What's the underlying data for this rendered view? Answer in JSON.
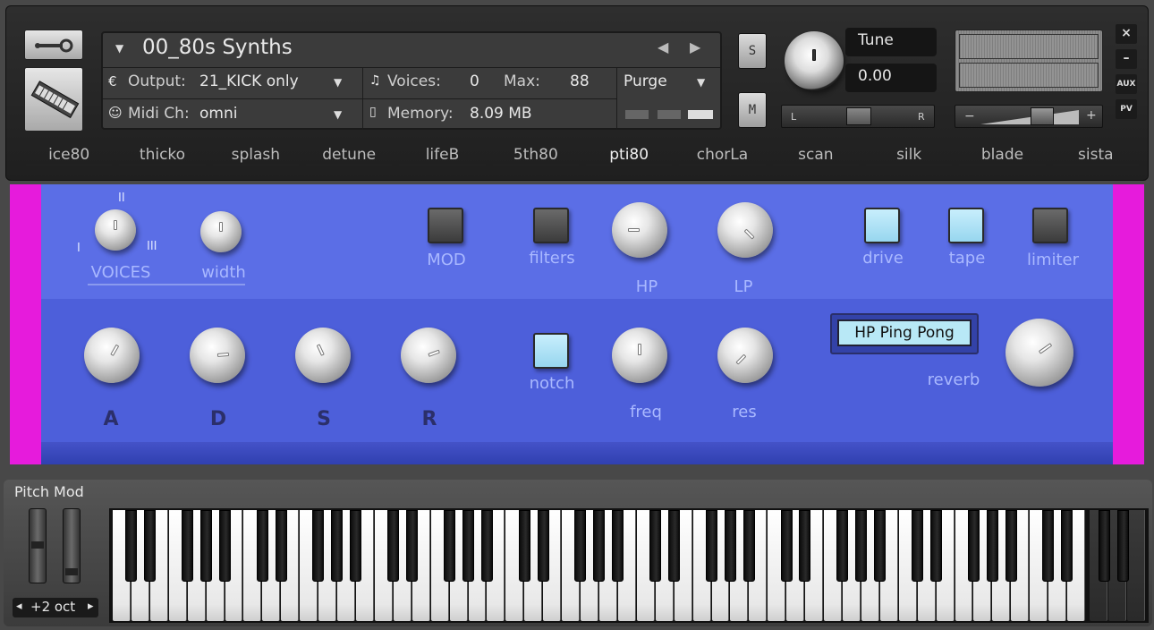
{
  "instrument": {
    "name": "00_80s Synths",
    "output_label": "Output:",
    "output_value": "21_KICK only",
    "midi_label": "Midi Ch:",
    "midi_value": "omni",
    "voices_label": "Voices:",
    "voices_value": "0",
    "max_label": "Max:",
    "max_value": "88",
    "memory_label": "Memory:",
    "memory_value": "8.09 MB",
    "purge_label": "Purge",
    "solo_label": "S",
    "mute_label": "M",
    "tune_label": "Tune",
    "tune_value": "0.00",
    "pan_left": "L",
    "pan_right": "R",
    "vol_minus": "−",
    "vol_plus": "+",
    "aux_label": "AUX",
    "pv_label": "PV",
    "close_label": "×",
    "minimize_label": "–"
  },
  "tabs": [
    "ice80",
    "thicko",
    "splash",
    "detune",
    "lifeB",
    "5th80",
    "pti80",
    "chorLa",
    "scan",
    "silk",
    "blade",
    "sista"
  ],
  "active_tab": "pti80",
  "panel": {
    "voices_label": "VOICES",
    "voices_marks": [
      "I",
      "II",
      "III"
    ],
    "width_label": "width",
    "mod_label": "MOD",
    "filters_label": "filters",
    "hp_label": "HP",
    "lp_label": "LP",
    "drive_label": "drive",
    "tape_label": "tape",
    "limiter_label": "limiter",
    "a_label": "A",
    "d_label": "D",
    "s_label": "S",
    "r_label": "R",
    "notch_label": "notch",
    "freq_label": "freq",
    "res_label": "res",
    "delay_mode": "HP Ping Pong",
    "reverb_label": "reverb",
    "toggles": {
      "mod": false,
      "filters": false,
      "drive": true,
      "tape": true,
      "limiter": false,
      "notch": true
    }
  },
  "keyboard": {
    "pitch_mod_label": "Pitch Mod",
    "octave_label": "+2 oct",
    "octave_left": "◂",
    "octave_right": "▸"
  },
  "colors": {
    "panel_blue": "#5b6ee6",
    "accent_magenta": "#e61bdc",
    "toggle_on": "#b8e8f6"
  }
}
